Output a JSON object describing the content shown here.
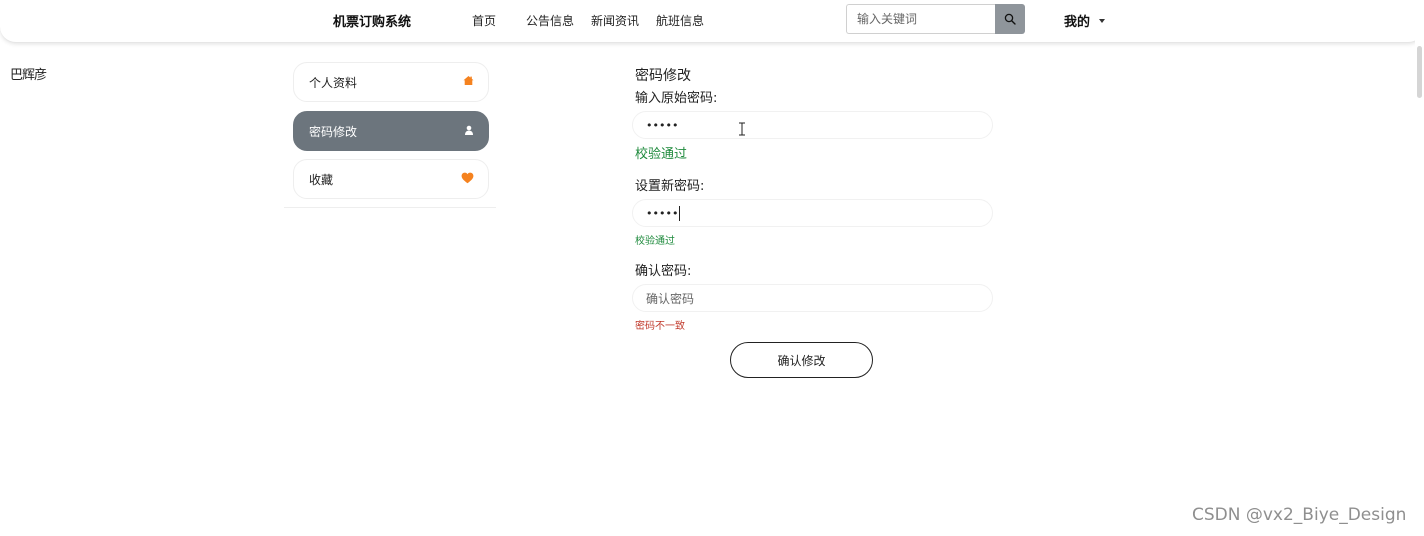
{
  "header": {
    "brand": "机票订购系统",
    "nav": [
      {
        "label": "首页"
      },
      {
        "label": "公告信息"
      },
      {
        "label": "新闻资讯"
      },
      {
        "label": "航班信息"
      }
    ],
    "search": {
      "placeholder": "输入关键词",
      "value": ""
    },
    "user_menu_label": "我的"
  },
  "stray_text": "巴辉彦",
  "sidebar": {
    "items": [
      {
        "label": "个人资料",
        "icon": "home-icon",
        "icon_color": "#f5821f",
        "active": false
      },
      {
        "label": "密码修改",
        "icon": "user-icon",
        "icon_color": "#ffffff",
        "active": true
      },
      {
        "label": "收藏",
        "icon": "heart-icon",
        "icon_color": "#f5821f",
        "active": false
      }
    ]
  },
  "form": {
    "title": "密码修改",
    "old_password": {
      "label": "输入原始密码:",
      "value": "•••••",
      "message": "校验通过"
    },
    "new_password": {
      "label": "设置新密码:",
      "value": "•••••",
      "message": "校验通过"
    },
    "confirm_password": {
      "label": "确认密码:",
      "placeholder": "确认密码",
      "value": "",
      "message": "密码不一致"
    },
    "submit_label": "确认修改"
  },
  "colors": {
    "active_item_bg": "#6c757d",
    "valid": "#1e8a3c",
    "invalid": "#c0392b",
    "search_button_bg": "#8f959b"
  },
  "watermark": "CSDN @vx2_Biye_Design"
}
